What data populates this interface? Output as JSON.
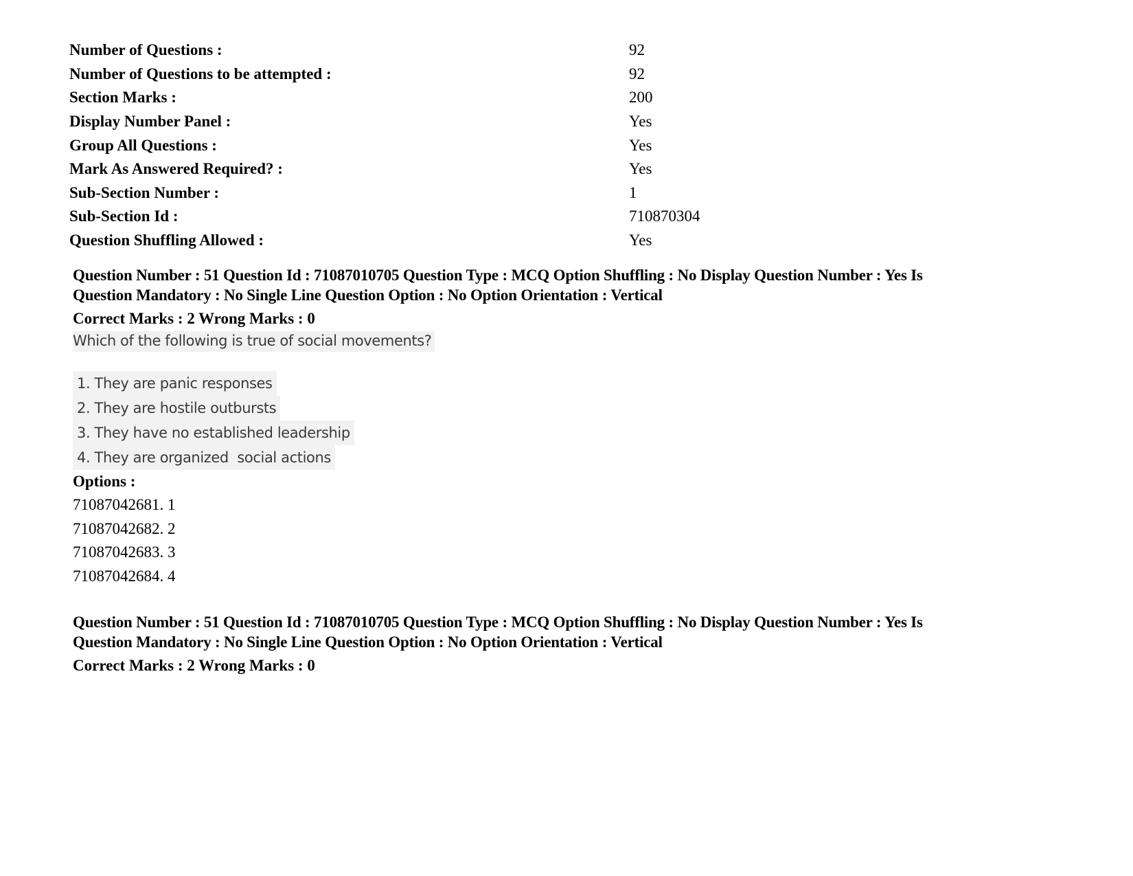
{
  "section_info": [
    {
      "label": "Number of Questions :",
      "value": "92"
    },
    {
      "label": "Number of Questions to be attempted :",
      "value": "92"
    },
    {
      "label": "Section Marks :",
      "value": "200"
    },
    {
      "label": "Display Number Panel :",
      "value": "Yes"
    },
    {
      "label": "Group All Questions :",
      "value": "Yes"
    },
    {
      "label": "Mark As Answered Required? :",
      "value": "Yes"
    },
    {
      "label": "Sub-Section Number :",
      "value": "1"
    },
    {
      "label": "Sub-Section Id :",
      "value": "710870304"
    },
    {
      "label": "Question Shuffling Allowed :",
      "value": "Yes"
    }
  ],
  "questions": [
    {
      "header_line1": "Question Number : 51 Question Id : 71087010705 Question Type : MCQ Option Shuffling : No Display Question Number : Yes Is",
      "header_line2": "Question Mandatory : No Single Line Question Option : No Option Orientation : Vertical",
      "marks": "Correct Marks : 2 Wrong Marks : 0",
      "stem": "Which of the following is true of social movements?",
      "choices": [
        "1. They are panic responses",
        "2. They are hostile outbursts",
        "3. They have no established leadership",
        "4. They are organized  social actions"
      ],
      "options_title": "Options :",
      "options": [
        "71087042681. 1",
        "71087042682. 2",
        "71087042683. 3",
        "71087042684. 4"
      ]
    },
    {
      "header_line1": "Question Number : 51 Question Id : 71087010705 Question Type : MCQ Option Shuffling : No Display Question Number : Yes Is",
      "header_line2": "Question Mandatory : No Single Line Question Option : No Option Orientation : Vertical",
      "marks": "Correct Marks : 2 Wrong Marks : 0"
    }
  ]
}
